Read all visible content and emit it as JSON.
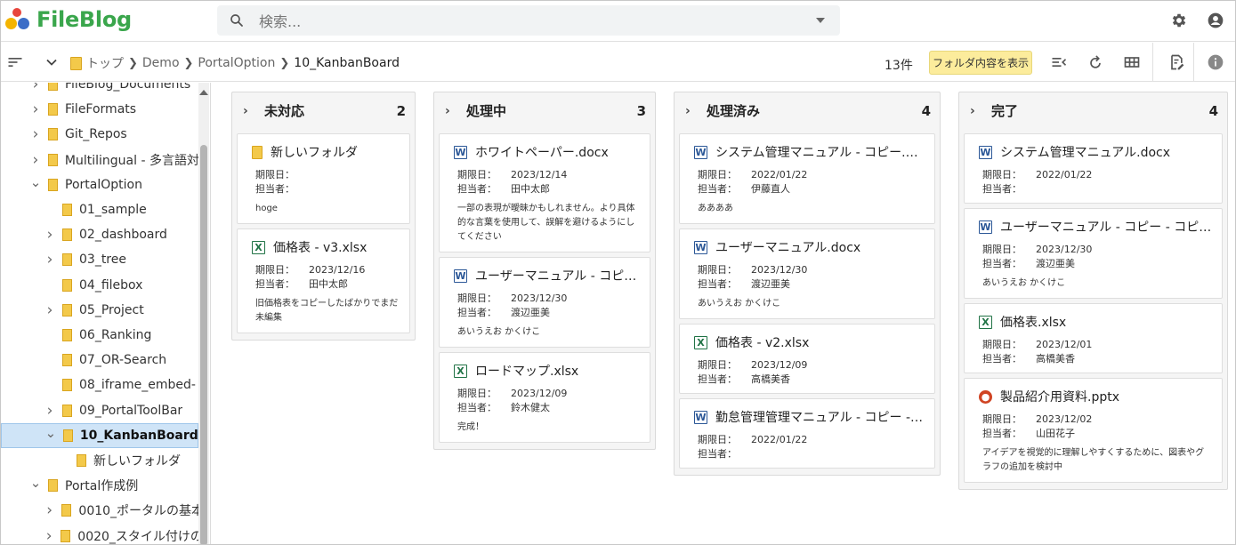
{
  "app": {
    "brand": "FileBlog",
    "brand_color": "#3aa64c"
  },
  "search": {
    "placeholder": "検索..."
  },
  "topbar_icons": [
    "gear-icon",
    "account-icon"
  ],
  "toolbar": {
    "breadcrumb": [
      "トップ",
      "Demo",
      "PortalOption",
      "10_KanbanBoard"
    ],
    "count": "13件",
    "show_folder_button": "フォルダ内容を表示"
  },
  "sidebar": {
    "items": [
      {
        "label": "FileBlog_Documents",
        "level": 1,
        "expanded": false
      },
      {
        "label": "FileFormats",
        "level": 1,
        "expanded": false
      },
      {
        "label": "Git_Repos",
        "level": 1,
        "expanded": false
      },
      {
        "label": "Multilingual - 多言語対",
        "level": 1,
        "expanded": false
      },
      {
        "label": "PortalOption",
        "level": 1,
        "expanded": true
      },
      {
        "label": "01_sample",
        "level": 2,
        "expanded": null
      },
      {
        "label": "02_dashboard",
        "level": 2,
        "expanded": false
      },
      {
        "label": "03_tree",
        "level": 2,
        "expanded": false
      },
      {
        "label": "04_filebox",
        "level": 2,
        "expanded": null
      },
      {
        "label": "05_Project",
        "level": 2,
        "expanded": false
      },
      {
        "label": "06_Ranking",
        "level": 2,
        "expanded": null
      },
      {
        "label": "07_OR-Search",
        "level": 2,
        "expanded": null
      },
      {
        "label": "08_iframe_embed-",
        "level": 2,
        "expanded": null
      },
      {
        "label": "09_PortalToolBar",
        "level": 2,
        "expanded": false
      },
      {
        "label": "10_KanbanBoard",
        "level": 2,
        "expanded": true,
        "selected": true
      },
      {
        "label": "新しいフォルダ",
        "level": 3,
        "expanded": null
      },
      {
        "label": "Portal作成例",
        "level": 1,
        "expanded": true
      },
      {
        "label": "0010_ポータルの基本",
        "level": 2,
        "expanded": false
      },
      {
        "label": "0020_スタイル付けの基",
        "level": 2,
        "expanded": false
      }
    ]
  },
  "labels": {
    "due": "期限日：",
    "owner": "担当者："
  },
  "columns": [
    {
      "title": "未対応",
      "count": "2",
      "cards": [
        {
          "type": "folder",
          "title": "新しいフォルダ",
          "due": "",
          "owner": "",
          "desc": "hoge"
        },
        {
          "type": "excel",
          "title": "価格表 - v3.xlsx",
          "due": "2023/12/16",
          "owner": "田中太郎",
          "desc": "旧価格表をコピーしたばかりでまだ未編集"
        }
      ]
    },
    {
      "title": "処理中",
      "count": "3",
      "cards": [
        {
          "type": "word",
          "title": "ホワイトペーパー.docx",
          "due": "2023/12/14",
          "owner": "田中太郎",
          "desc": "一部の表現が曖昧かもしれません。より具体的な言葉を使用して、誤解を避けるようにしてください"
        },
        {
          "type": "word",
          "title": "ユーザーマニュアル - コピー.docx",
          "due": "2023/12/30",
          "owner": "渡辺亜美",
          "desc": "あいうえお かくけこ"
        },
        {
          "type": "excel",
          "title": "ロードマップ.xlsx",
          "due": "2023/12/09",
          "owner": "鈴木健太",
          "desc": "完成！"
        }
      ]
    },
    {
      "title": "処理済み",
      "count": "4",
      "cards": [
        {
          "type": "word",
          "title": "システム管理マニュアル - コピー.docx",
          "due": "2022/01/22",
          "owner": "伊藤直人",
          "desc": "ああああ"
        },
        {
          "type": "word",
          "title": "ユーザーマニュアル.docx",
          "due": "2023/12/30",
          "owner": "渡辺亜美",
          "desc": "あいうえお かくけこ"
        },
        {
          "type": "excel",
          "title": "価格表 - v2.xlsx",
          "due": "2023/12/09",
          "owner": "高橋美香",
          "desc": ""
        },
        {
          "type": "word",
          "title": "勤怠管理管理マニュアル - コピー - コ…",
          "due": "2022/01/22",
          "owner": "",
          "desc": ""
        }
      ]
    },
    {
      "title": "完了",
      "count": "4",
      "cards": [
        {
          "type": "word",
          "title": "システム管理マニュアル.docx",
          "due": "2022/01/22",
          "owner": "",
          "desc": ""
        },
        {
          "type": "word",
          "title": "ユーザーマニュアル - コピー - コピー.docx",
          "due": "2023/12/30",
          "owner": "渡辺亜美",
          "desc": "あいうえお かくけこ"
        },
        {
          "type": "excel",
          "title": "価格表.xlsx",
          "due": "2023/12/01",
          "owner": "高橋美香",
          "desc": ""
        },
        {
          "type": "ppt",
          "title": "製品紹介用資料.pptx",
          "due": "2023/12/02",
          "owner": "山田花子",
          "desc": "アイデアを視覚的に理解しやすくするために、図表やグラフの追加を検討中"
        }
      ]
    }
  ]
}
